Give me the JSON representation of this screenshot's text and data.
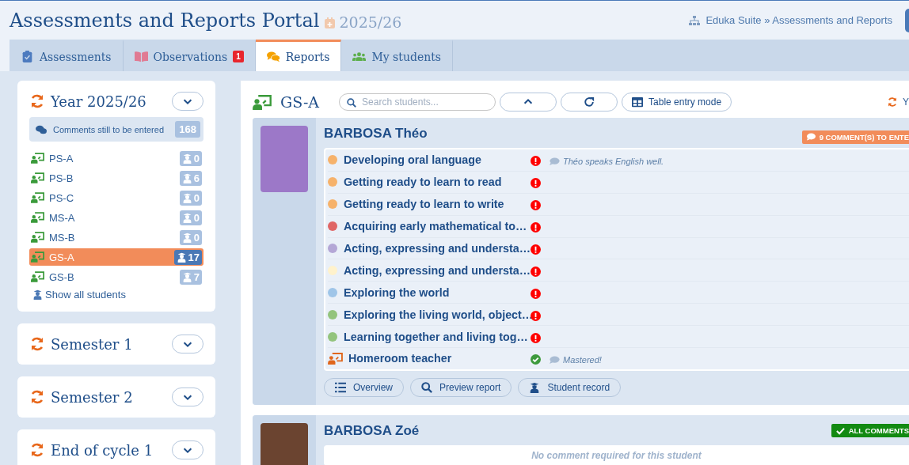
{
  "header": {
    "title": "Assessments and Reports Portal",
    "year": "2025/26",
    "breadcrumb": "Eduka Suite » Assessments and Reports"
  },
  "tabs": [
    {
      "label": "Assessments",
      "selected": false
    },
    {
      "label": "Observations",
      "badge": "1",
      "selected": false
    },
    {
      "label": "Reports",
      "selected": true
    },
    {
      "label": "My students",
      "selected": false
    }
  ],
  "sidebar": {
    "year_card": {
      "title": "Year 2025/26",
      "pending_label": "Comments still to be entered",
      "pending_count": "168",
      "classes": [
        {
          "name": "PS-A",
          "count": "0",
          "selected": false
        },
        {
          "name": "PS-B",
          "count": "6",
          "selected": false
        },
        {
          "name": "PS-C",
          "count": "0",
          "selected": false
        },
        {
          "name": "MS-A",
          "count": "0",
          "selected": false
        },
        {
          "name": "MS-B",
          "count": "0",
          "selected": false
        },
        {
          "name": "GS-A",
          "count": "17",
          "selected": true
        },
        {
          "name": "GS-B",
          "count": "7",
          "selected": false
        }
      ],
      "show_all": "Show all students"
    },
    "period_cards": [
      {
        "title": "Semester 1"
      },
      {
        "title": "Semester 2"
      },
      {
        "title": "End of cycle 1"
      }
    ]
  },
  "main": {
    "class_name": "GS-A",
    "search": {
      "placeholder": "Search students..."
    },
    "table_mode_button": "Table entry mode",
    "right_label": "Y",
    "students": [
      {
        "name": "BARBOSA Théo",
        "status": {
          "kind": "pending",
          "label": "9 COMMENT(S) TO ENTE"
        },
        "rows": [
          {
            "kind": "domain",
            "label": "Developing oral language",
            "color": "#f6b26b",
            "done": false,
            "comment": "Théo speaks English well."
          },
          {
            "kind": "domain",
            "label": "Getting ready to learn to read",
            "color": "#f6b26b",
            "done": false
          },
          {
            "kind": "domain",
            "label": "Getting ready to learn to write",
            "color": "#f6b26b",
            "done": false
          },
          {
            "kind": "domain",
            "label": "Acquiring early mathematical to…",
            "color": "#e06666",
            "done": false
          },
          {
            "kind": "domain",
            "label": "Acting, expressing and understa…",
            "color": "#b4a7d6",
            "done": false
          },
          {
            "kind": "domain",
            "label": "Acting, expressing and understa…",
            "color": "#fff2cc",
            "done": false
          },
          {
            "kind": "domain",
            "label": "Exploring the world",
            "color": "#9fc5e8",
            "done": false
          },
          {
            "kind": "domain",
            "label": "Exploring the living world, object…",
            "color": "#93c47d",
            "done": false
          },
          {
            "kind": "domain",
            "label": "Learning together and living tog…",
            "color": "#93c47d",
            "done": false
          },
          {
            "kind": "teacher",
            "label": "Homeroom teacher",
            "done": true,
            "comment": "Mastered!"
          }
        ],
        "buttons": [
          "Overview",
          "Preview report",
          "Student record"
        ]
      },
      {
        "name": "BARBOSA Zoé",
        "status": {
          "kind": "complete",
          "label": "ALL COMMENTS"
        },
        "note": "No comment required for this student"
      }
    ]
  }
}
